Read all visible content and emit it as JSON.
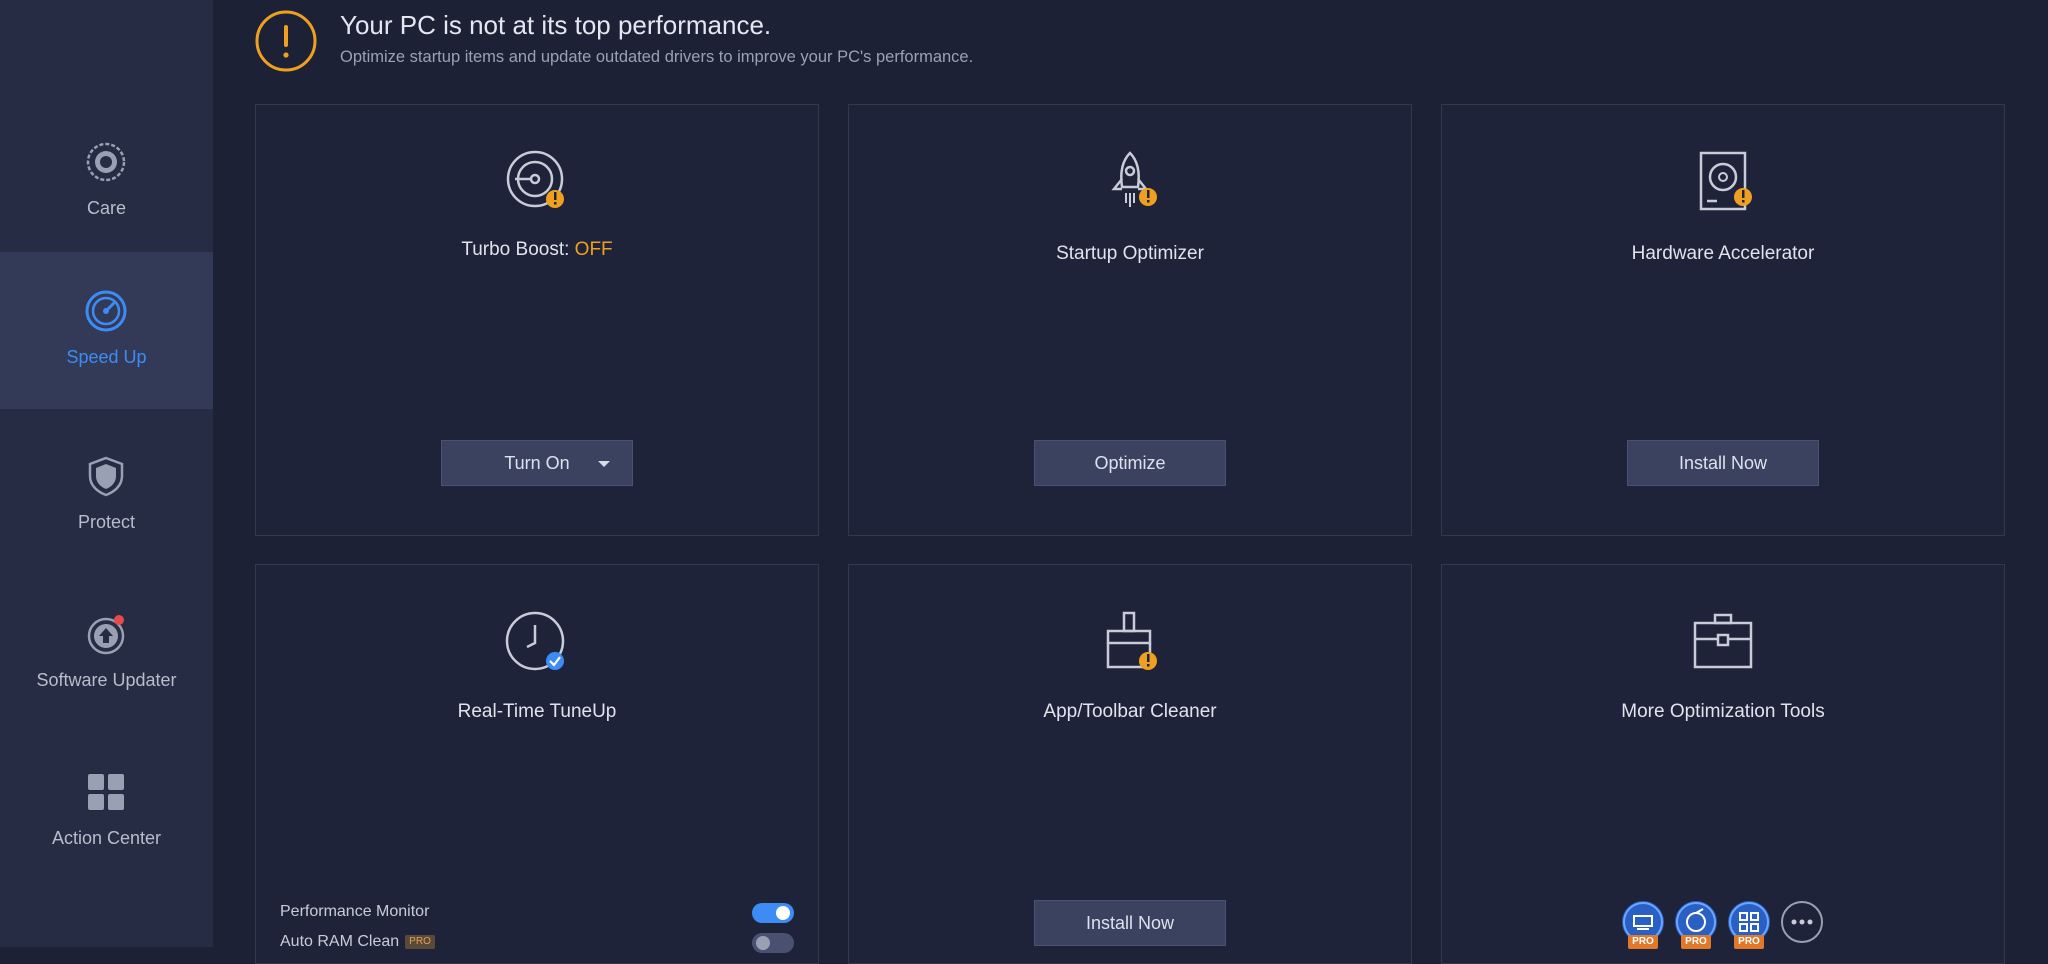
{
  "sidebar": {
    "top_partial_label": "",
    "items": [
      {
        "label": "Care",
        "icon": "care-icon"
      },
      {
        "label": "Speed Up",
        "icon": "speedup-icon",
        "active": true
      },
      {
        "label": "Protect",
        "icon": "shield-icon"
      },
      {
        "label": "Software Updater",
        "icon": "software-updater-icon"
      },
      {
        "label": "Action Center",
        "icon": "action-center-icon"
      }
    ]
  },
  "alert": {
    "icon": "warning-icon",
    "title": "Your PC is not at its top performance.",
    "subtitle": "Optimize startup items and update outdated drivers to improve your PC's performance."
  },
  "cards": {
    "turbo": {
      "title_prefix": "Turbo Boost: ",
      "status": "OFF",
      "button": "Turn On",
      "icon": "turbo-boost-icon"
    },
    "startup": {
      "title": "Startup Optimizer",
      "button": "Optimize",
      "icon": "rocket-icon"
    },
    "hardware": {
      "title": "Hardware Accelerator",
      "button": "Install Now",
      "icon": "hard-drive-icon"
    },
    "realtime": {
      "title": "Real-Time TuneUp",
      "icon": "clock-check-icon",
      "toggles": [
        {
          "label": "Performance Monitor",
          "on": true
        },
        {
          "label": "Auto RAM Clean",
          "on": false,
          "badge": "PRO"
        }
      ]
    },
    "cleaner": {
      "title": "App/Toolbar Cleaner",
      "button": "Install Now",
      "icon": "toolbar-cleaner-icon"
    },
    "more": {
      "title": "More Optimization Tools",
      "icon": "toolbox-icon",
      "tools": [
        {
          "icon": "pro-tool-1-icon",
          "badge": "PRO"
        },
        {
          "icon": "pro-tool-2-icon",
          "badge": "PRO"
        },
        {
          "icon": "pro-tool-3-icon",
          "badge": "PRO"
        },
        {
          "icon": "more-dots-icon"
        }
      ]
    }
  },
  "colors": {
    "background": "#1c2136",
    "sidebar": "#262c44",
    "accent_blue": "#3d8cf5",
    "warning_orange": "#f0a020"
  }
}
